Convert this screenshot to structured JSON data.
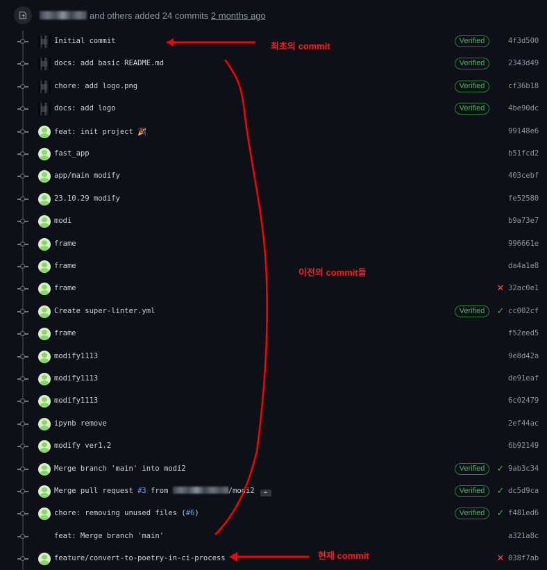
{
  "header": {
    "text": "and others added 24 commits",
    "time": "2 months ago",
    "icon": "push-icon"
  },
  "commits": [
    {
      "avatar": "pixel",
      "message": "Initial commit",
      "verified": true,
      "status": "",
      "sha": "4f3d500"
    },
    {
      "avatar": "pixel",
      "message": "docs: add basic README.md",
      "verified": true,
      "status": "",
      "sha": "2343d49"
    },
    {
      "avatar": "pixel",
      "message": "chore: add logo.png",
      "verified": true,
      "status": "",
      "sha": "cf36b18"
    },
    {
      "avatar": "pixel",
      "message": "docs: add logo",
      "verified": true,
      "status": "",
      "sha": "4be90dc"
    },
    {
      "avatar": "round",
      "message": "feat: init project 🎉",
      "verified": false,
      "status": "",
      "sha": "99148e6"
    },
    {
      "avatar": "round",
      "message": "fast_app",
      "verified": false,
      "status": "",
      "sha": "b51fcd2"
    },
    {
      "avatar": "round",
      "message": "app/main modify",
      "verified": false,
      "status": "",
      "sha": "403cebf"
    },
    {
      "avatar": "round",
      "message": "23.10.29 modify",
      "verified": false,
      "status": "",
      "sha": "fe52580"
    },
    {
      "avatar": "round",
      "message": "modi",
      "verified": false,
      "status": "",
      "sha": "b9a73e7"
    },
    {
      "avatar": "round",
      "message": "frame",
      "verified": false,
      "status": "",
      "sha": "996661e"
    },
    {
      "avatar": "round",
      "message": "frame",
      "verified": false,
      "status": "",
      "sha": "da4a1e8"
    },
    {
      "avatar": "round",
      "message": "frame",
      "verified": false,
      "status": "fail",
      "sha": "32ac0e1"
    },
    {
      "avatar": "round",
      "message": "Create super-linter.yml",
      "verified": true,
      "status": "ok",
      "sha": "cc002cf"
    },
    {
      "avatar": "round",
      "message": "frame",
      "verified": false,
      "status": "",
      "sha": "f52eed5"
    },
    {
      "avatar": "round",
      "message": "modify1113",
      "verified": false,
      "status": "",
      "sha": "9e8d42a"
    },
    {
      "avatar": "round",
      "message": "modify1113",
      "verified": false,
      "status": "",
      "sha": "de91eaf"
    },
    {
      "avatar": "round",
      "message": "modify1113",
      "verified": false,
      "status": "",
      "sha": "6c02479"
    },
    {
      "avatar": "round",
      "message": "ipynb remove",
      "verified": false,
      "status": "",
      "sha": "2ef44ac"
    },
    {
      "avatar": "round",
      "message": "modify ver1.2",
      "verified": false,
      "status": "",
      "sha": "6b92149"
    },
    {
      "avatar": "round",
      "message": "Merge branch 'main' into modi2",
      "verified": true,
      "status": "ok",
      "sha": "9ab3c34"
    },
    {
      "avatar": "round",
      "message": "Merge pull request #3 from ███████/modi2",
      "message_parts": {
        "before": "Merge pull request ",
        "ref": "#3",
        "after": " from ",
        "suffix": "/modi2"
      },
      "verified": true,
      "status": "ok",
      "sha": "dc5d9ca"
    },
    {
      "avatar": "round",
      "message": "chore: removing unused files (#6)",
      "message_parts": {
        "before": "chore: removing unused files (",
        "ref": "#6",
        "after": ")"
      },
      "verified": true,
      "status": "ok",
      "sha": "f481ed6"
    },
    {
      "avatar": "none",
      "message": "feat: Merge branch 'main'",
      "verified": false,
      "status": "",
      "sha": "a321a8c"
    },
    {
      "avatar": "round",
      "message": "feature/convert-to-poetry-in-ci-process",
      "verified": false,
      "status": "fail",
      "sha": "038f7ab"
    }
  ],
  "labels": {
    "verified": "Verified",
    "ellipsis": "…",
    "status_ok": "✓",
    "status_fail": "✕"
  },
  "annotations": {
    "first": "최초의 commit",
    "previous": "이전의 commit들",
    "current": "현재 commit"
  },
  "colors": {
    "background": "#0d1117",
    "verified_green": "#3fb950",
    "fail_red": "#f85149",
    "annotation_red": "#ff1a1a",
    "link_blue": "#58a6ff"
  }
}
